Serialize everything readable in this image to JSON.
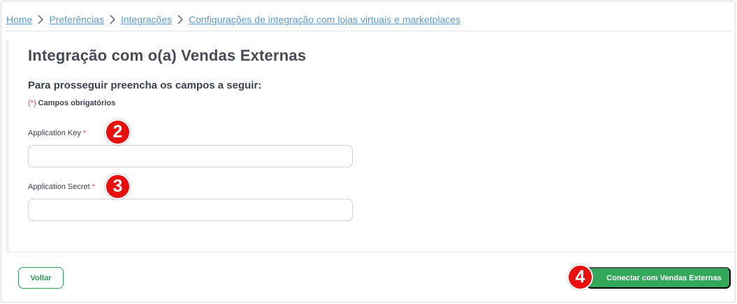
{
  "breadcrumb": {
    "items": [
      {
        "label": "Home"
      },
      {
        "label": "Preferências"
      },
      {
        "label": "Integrações"
      },
      {
        "label": "Configurações de integração com lojas virtuais e marketplaces"
      }
    ],
    "separator_icon": "chevron-right-icon"
  },
  "page": {
    "title": "Integração com o(a) Vendas Externas",
    "subtitle": "Para prosseguir preencha os campos a seguir:",
    "required_marker": "(*)",
    "required_text": "Campos obrigatórios"
  },
  "fields": {
    "application_key": {
      "label": "Application Key",
      "asterisk": "*",
      "value": "",
      "placeholder": ""
    },
    "application_secret": {
      "label": "Application Secret",
      "asterisk": "*",
      "value": "",
      "placeholder": ""
    }
  },
  "badges": {
    "key": "2",
    "secret": "3",
    "connect": "4"
  },
  "footer": {
    "back_label": "Voltar",
    "connect_label": "Conectar com Vendas Externas"
  },
  "colors": {
    "link": "#5b9bd1",
    "primary_green": "#34a85a",
    "required_red": "#e0415a",
    "badge_red": "#e80f0f"
  }
}
